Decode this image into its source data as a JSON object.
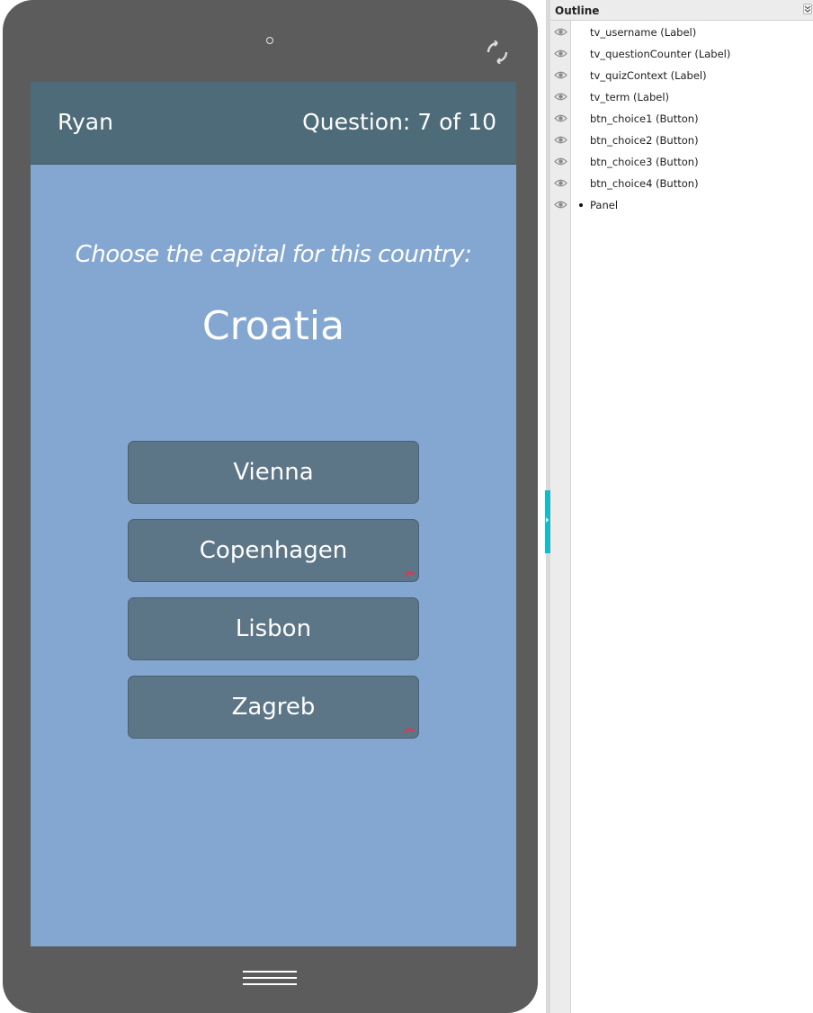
{
  "device": {
    "top_bar": {
      "username": "Ryan",
      "question_counter": "Question: 7 of 10"
    },
    "quiz_context": "Choose the capital for this country:",
    "term": "Croatia",
    "choices": [
      {
        "label": "Vienna",
        "has_link": false
      },
      {
        "label": "Copenhagen",
        "has_link": true
      },
      {
        "label": "Lisbon",
        "has_link": false
      },
      {
        "label": "Zagreb",
        "has_link": true
      }
    ],
    "icons": {
      "rotate": "rotate-icon",
      "home": "home-icon",
      "camera": "camera-icon",
      "link": "link-icon"
    }
  },
  "outline": {
    "title": "Outline",
    "items": [
      {
        "label": "tv_username (Label)",
        "bullet": false
      },
      {
        "label": "tv_questionCounter (Label)",
        "bullet": false
      },
      {
        "label": "tv_quizContext (Label)",
        "bullet": false
      },
      {
        "label": "tv_term (Label)",
        "bullet": false
      },
      {
        "label": "btn_choice1 (Button)",
        "bullet": false
      },
      {
        "label": "btn_choice2 (Button)",
        "bullet": false
      },
      {
        "label": "btn_choice3 (Button)",
        "bullet": false
      },
      {
        "label": "btn_choice4 (Button)",
        "bullet": false
      },
      {
        "label": "Panel",
        "bullet": true
      }
    ]
  },
  "colors": {
    "screen_bg": "#84a7d1",
    "top_bar_bg": "#4d6b78",
    "button_bg": "#5c7587",
    "device_bg": "#5c5c5c",
    "splitter_accent": "#19b9c8",
    "link_icon": "#e8334f"
  }
}
